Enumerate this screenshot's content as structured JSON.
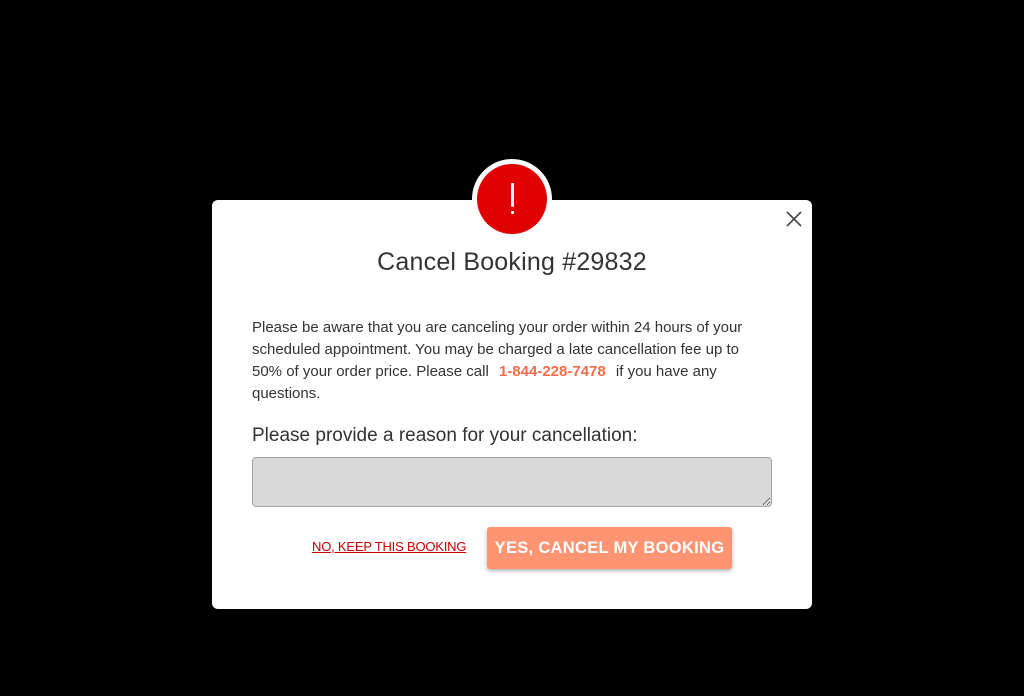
{
  "modal": {
    "title": "Cancel Booking #29832",
    "message_part1": "Please be aware that you are canceling your order within 24 hours of your scheduled appointment. You may be charged a late cancellation fee up to 50% of your order price. Please call",
    "phone": "1-844-228-7478",
    "message_part2": "if you have any questions.",
    "reason_label": "Please provide a reason for your cancellation:",
    "reason_value": "",
    "keep_label": "NO, KEEP THIS BOOKING",
    "confirm_label": "YES, CANCEL MY BOOKING"
  },
  "icons": {
    "alert": "exclamation-icon",
    "close": "close-icon"
  },
  "colors": {
    "backdrop": "#000000",
    "alert_red": "#e00000",
    "phone_accent": "#f26b4a",
    "keep_link": "#cc0000",
    "confirm_button": "#ff9473",
    "input_bg": "#d9d9d9"
  }
}
